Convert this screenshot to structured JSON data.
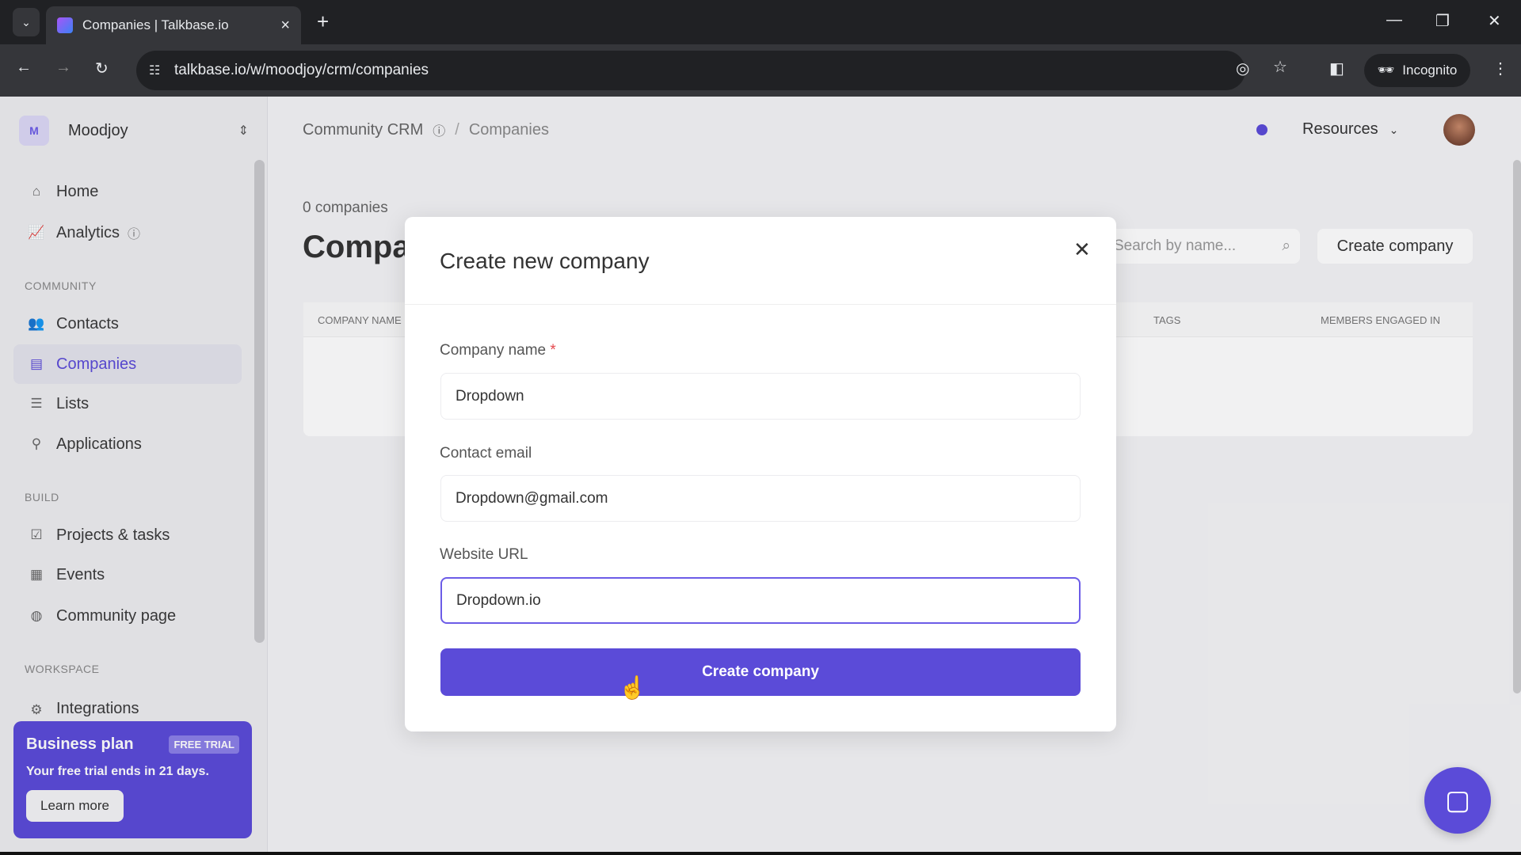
{
  "browser": {
    "tab_title": "Companies | Talkbase.io",
    "url": "talkbase.io/w/moodjoy/crm/companies",
    "incognito": "Incognito"
  },
  "sidebar": {
    "workspace_initial": "M",
    "workspace": "Moodjoy",
    "items_top": [
      {
        "label": "Home",
        "icon": "home-icon"
      },
      {
        "label": "Analytics",
        "icon": "chart-icon"
      }
    ],
    "community_header": "COMMUNITY",
    "community": [
      {
        "label": "Contacts"
      },
      {
        "label": "Companies"
      },
      {
        "label": "Lists"
      },
      {
        "label": "Applications"
      }
    ],
    "build_header": "BUILD",
    "build": [
      {
        "label": "Projects & tasks"
      },
      {
        "label": "Events"
      },
      {
        "label": "Community page"
      }
    ],
    "workspace_header": "WORKSPACE",
    "workspace_items": [
      {
        "label": "Integrations"
      }
    ],
    "plan": {
      "title": "Business plan",
      "badge": "FREE TRIAL",
      "text": "Your free trial ends in 21 days.",
      "button": "Learn more"
    }
  },
  "header": {
    "breadcrumb_root": "Community CRM",
    "breadcrumb_sep": "/",
    "breadcrumb_current": "Companies",
    "resources": "Resources"
  },
  "page": {
    "count": "0 companies",
    "title": "Companies",
    "search_placeholder": "Search by name...",
    "create_button": "Create company",
    "columns": [
      "COMPANY NAME",
      "TAGS",
      "MEMBERS ENGAGED IN"
    ]
  },
  "modal": {
    "title": "Create new company",
    "required_mark": "*",
    "fields": [
      {
        "label": "Company name",
        "value": "Dropdown"
      },
      {
        "label": "Contact email",
        "value": "Dropdown@gmail.com"
      },
      {
        "label": "Website URL",
        "value": "Dropdown.io"
      }
    ],
    "submit": "Create company"
  }
}
